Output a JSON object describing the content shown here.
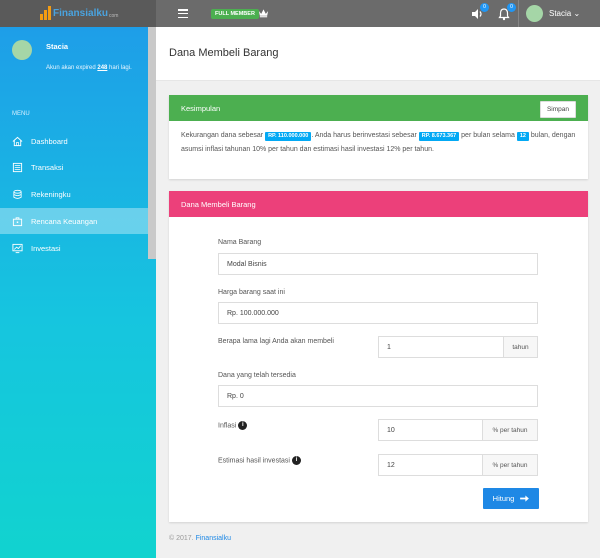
{
  "topbar": {
    "logo_text": "Finansialku",
    "logo_sub": "com",
    "member_badge": "FULL MEMBER",
    "notif_sound_count": "0",
    "notif_bell_count": "0",
    "user_name": "Stacia"
  },
  "sidebar": {
    "user_name": "Stacia",
    "expire_prefix": "Akun akan expired ",
    "expire_days": "248",
    "expire_suffix": " hari lagi.",
    "menu_heading": "MENU",
    "items": [
      {
        "label": "Dashboard",
        "icon": "home-icon"
      },
      {
        "label": "Transaksi",
        "icon": "list-icon"
      },
      {
        "label": "Rekeningku",
        "icon": "coins-icon"
      },
      {
        "label": "Rencana Keuangan",
        "icon": "briefcase-icon",
        "active": true
      },
      {
        "label": "Investasi",
        "icon": "monitor-chart-icon"
      }
    ]
  },
  "page": {
    "title": "Dana Membeli Barang"
  },
  "summary_card": {
    "title": "Kesimpulan",
    "save_label": "Simpan",
    "text_1": "Kekurangan dana sebesar ",
    "shortfall": "RP. 110.000.000",
    "text_2": ". Anda harus berinvestasi sebesar ",
    "monthly": "RP. 8.673.367",
    "text_3": " per bulan selama ",
    "months": "12",
    "text_4": " bulan, dengan asumsi inflasi tahunan 10% per tahun dan estimasi hasil investasi 12% per tahun."
  },
  "form_card": {
    "title": "Dana Membeli Barang",
    "item_label": "Nama Barang",
    "item_value": "Modal Bisnis",
    "price_label": "Harga barang saat ini",
    "price_value": "Rp. 100.000.000",
    "years_label": "Berapa lama lagi Anda akan membeli",
    "years_value": "1",
    "years_unit": "tahun",
    "funds_label": "Dana yang telah tersedia",
    "funds_value": "Rp. 0",
    "inflation_label": "Inflasi",
    "inflation_value": "10",
    "inflation_unit": "% per tahun",
    "return_label": "Estimasi hasil investasi",
    "return_value": "12",
    "return_unit": "% per tahun",
    "submit_label": "Hitung"
  },
  "footer": {
    "copyright": "© 2017. ",
    "brand": "Finansialku"
  },
  "colors": {
    "sidebar_top": "#1e9ee8",
    "sidebar_bottom": "#11d3cf",
    "summary_header": "#4caf50",
    "form_header": "#ec407a",
    "button": "#1e88e5",
    "chip": "#03a9f4"
  }
}
